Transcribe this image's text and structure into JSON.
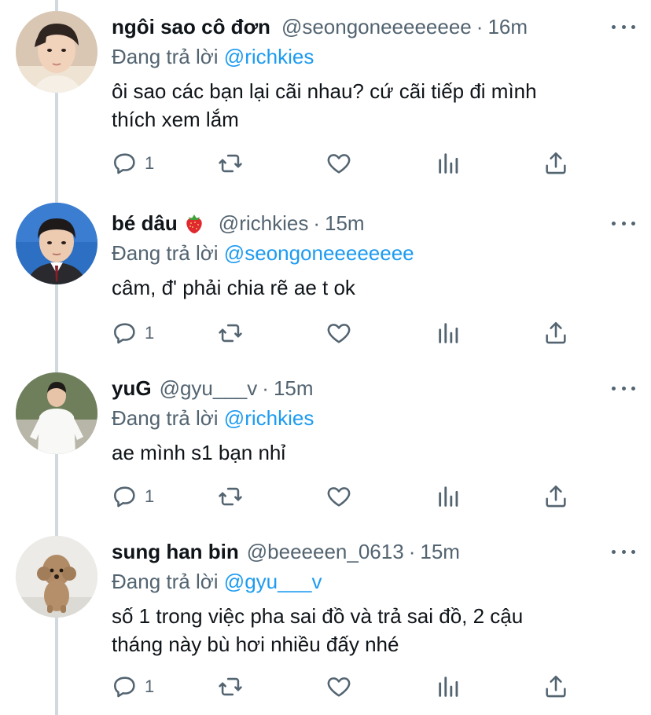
{
  "colors": {
    "link": "#1d9bf0",
    "secondary_text": "#536471",
    "thread_line": "#cfd9de"
  },
  "reply_prefix": "Đang trả lời",
  "tweets": [
    {
      "display_name": "ngôi sao cô đơn",
      "handle": "@seongoneeeeeeee",
      "separator": "·",
      "time": "16m",
      "reply_to": "@richkies",
      "text_lines": [
        "ôi sao các bạn lại cãi nhau? cứ cãi tiếp đi mình",
        "thích xem lắm"
      ],
      "reply_count": "1",
      "avatar": "avatar-boy-light-shirt"
    },
    {
      "display_name": "bé dâu",
      "emoji": "strawberry-emoji",
      "handle": "@richkies",
      "separator": "·",
      "time": "15m",
      "reply_to": "@seongoneeeeeeee",
      "text_lines": [
        "câm, đ' phải chia rẽ ae t ok"
      ],
      "reply_count": "1",
      "avatar": "avatar-boy-school-uniform"
    },
    {
      "display_name": "yuG",
      "handle": "@gyu___v",
      "separator": "·",
      "time": "15m",
      "reply_to": "@richkies",
      "text_lines": [
        "ae mình s1 bạn nhỉ"
      ],
      "reply_count": "1",
      "avatar": "avatar-boy-white-tshirt"
    },
    {
      "display_name": "sung han bin",
      "handle": "@beeeeen_0613",
      "separator": "·",
      "time": "15m",
      "reply_to": "@gyu___v",
      "text_lines": [
        "số 1 trong việc pha sai đồ và trả sai đồ, 2 cậu",
        "tháng này bù hơi nhiều đấy nhé"
      ],
      "reply_count": "1",
      "avatar": "avatar-poodle-dog"
    }
  ]
}
